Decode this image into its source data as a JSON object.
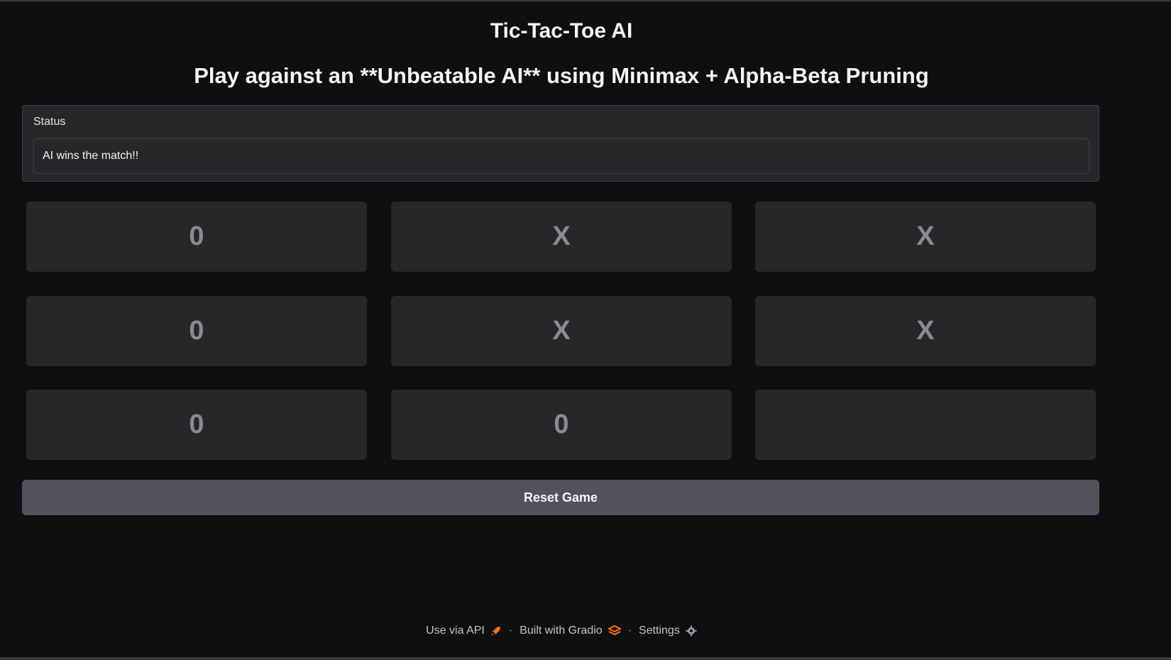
{
  "header": {
    "title": "Tic-Tac-Toe AI",
    "subtitle": "Play against an **Unbeatable AI** using Minimax + Alpha-Beta Pruning"
  },
  "status": {
    "label": "Status",
    "value": "AI wins the match!!"
  },
  "board": {
    "cells": [
      "0",
      "X",
      "X",
      "0",
      "X",
      "X",
      "0",
      "0",
      ""
    ]
  },
  "reset_label": "Reset Game",
  "footer": {
    "api": "Use via API",
    "separator": "·",
    "built": "Built with Gradio",
    "settings": "Settings"
  },
  "colors": {
    "background": "#0f0f11",
    "panel": "#27272a",
    "reset_button": "#52525b",
    "accent": "#f97316"
  }
}
